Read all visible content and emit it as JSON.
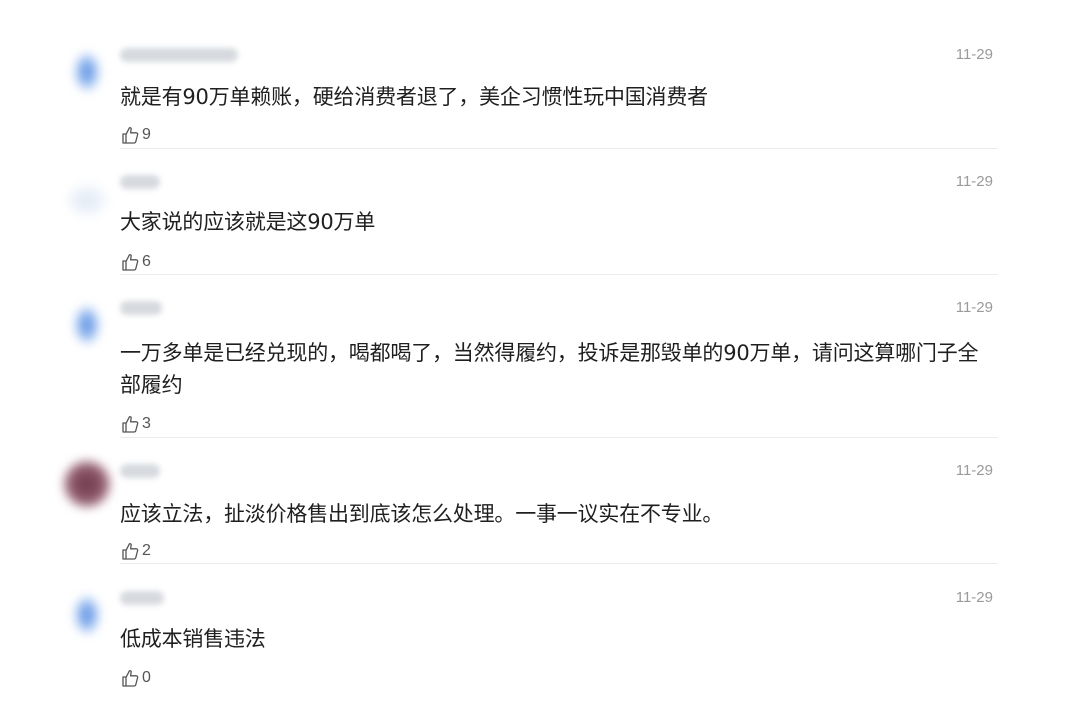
{
  "comments": [
    {
      "avatar_style": "blue",
      "date": "11-29",
      "text": "就是有90万单赖账，硬给消费者退了，美企习惯性玩中国消费者",
      "likes": "9"
    },
    {
      "avatar_style": "faint",
      "date": "11-29",
      "text": "大家说的应该就是这90万单",
      "likes": "6"
    },
    {
      "avatar_style": "blue",
      "date": "11-29",
      "text": "一万多单是已经兑现的，喝都喝了，当然得履约，投诉是那毁单的90万单，请问这算哪门子全部履约",
      "likes": "3"
    },
    {
      "avatar_style": "dark",
      "date": "11-29",
      "text": "应该立法，扯淡价格售出到底该怎么处理。一事一议实在不专业。",
      "likes": "2"
    },
    {
      "avatar_style": "blue",
      "date": "11-29",
      "text": "低成本销售违法",
      "likes": "0"
    }
  ],
  "icons": {
    "like": "thumbs-up-icon"
  },
  "colors": {
    "date": "#9a9a9a",
    "text": "#1f1f1f",
    "like": "#555555",
    "divider": "#ececec"
  }
}
